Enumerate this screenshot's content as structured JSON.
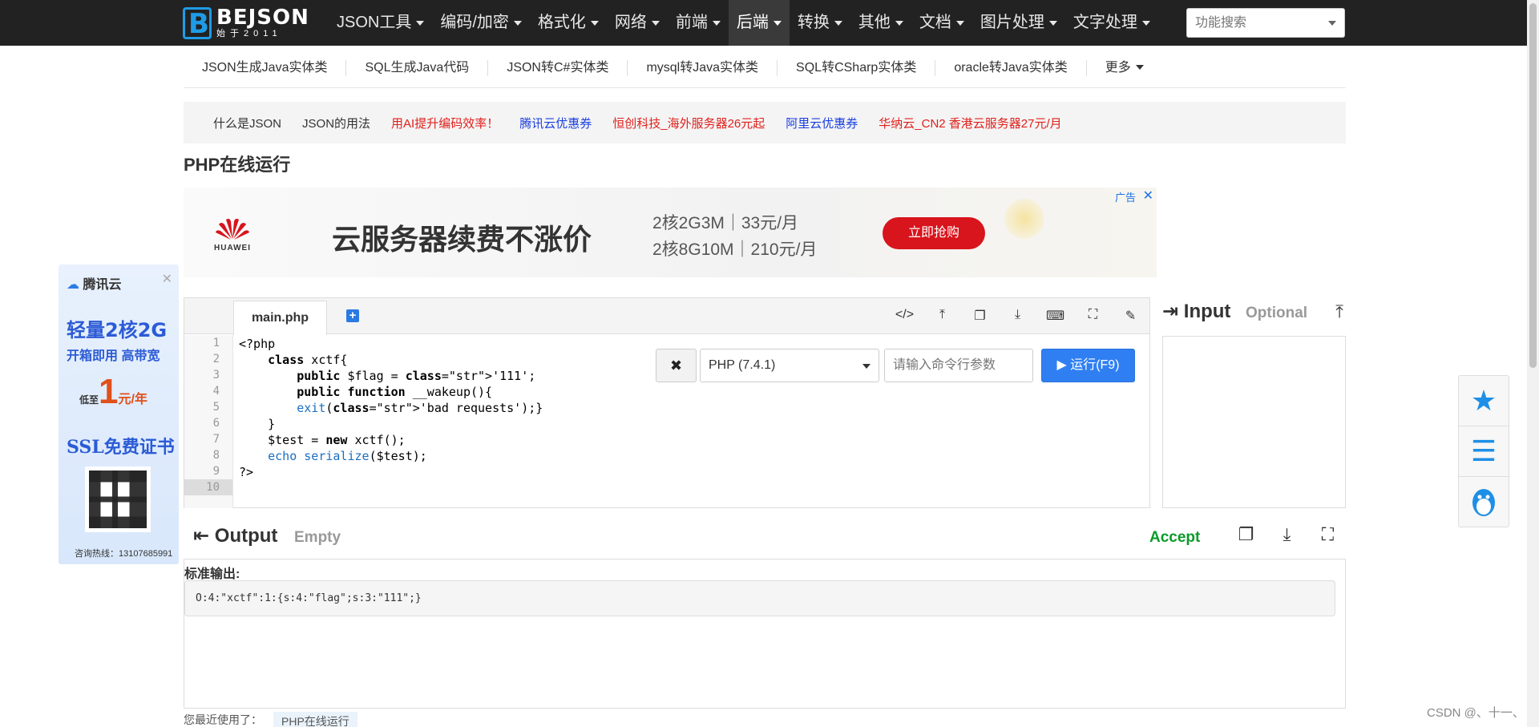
{
  "topnav": {
    "logo_title": "BEJSON",
    "logo_sub": "始于2011",
    "items": [
      {
        "label": "JSON工具",
        "active": false
      },
      {
        "label": "编码/加密",
        "active": false
      },
      {
        "label": "格式化",
        "active": false
      },
      {
        "label": "网络",
        "active": false
      },
      {
        "label": "前端",
        "active": false
      },
      {
        "label": "后端",
        "active": true
      },
      {
        "label": "转换",
        "active": false
      },
      {
        "label": "其他",
        "active": false
      },
      {
        "label": "文档",
        "active": false
      },
      {
        "label": "图片处理",
        "active": false
      },
      {
        "label": "文字处理",
        "active": false
      }
    ],
    "search_placeholder": "功能搜索"
  },
  "subnav": {
    "items": [
      "JSON生成Java实体类",
      "SQL生成Java代码",
      "JSON转C#实体类",
      "mysql转Java实体类",
      "SQL转CSharp实体类",
      "oracle转Java实体类",
      "更多"
    ]
  },
  "linkbar": {
    "items": [
      {
        "label": "什么是JSON",
        "color": "#333333"
      },
      {
        "label": "JSON的用法",
        "color": "#333333"
      },
      {
        "label": "用AI提升编码效率！",
        "color": "#e0201b"
      },
      {
        "label": "腾讯云优惠券",
        "color": "#1a3ee0"
      },
      {
        "label": "恒创科技_海外服务器26元起",
        "color": "#e0201b"
      },
      {
        "label": "阿里云优惠券",
        "color": "#1a3ee0"
      },
      {
        "label": "华纳云_CN2 香港云服务器27元/月",
        "color": "#e0201b"
      }
    ]
  },
  "page_title": "PHP在线运行",
  "banner": {
    "brand": "HUAWEI",
    "headline": "云服务器续费不涨价",
    "price1": "2核2G3M｜33元/月",
    "price2": "2核8G10M｜210元/月",
    "cta": "立即抢购",
    "ad_tag": "广告",
    "close": "✕"
  },
  "leftad": {
    "brand": "腾讯云",
    "line1": "轻量2核2G",
    "line2": "开箱即用 高带宽",
    "price_pre": "低至",
    "price": "1",
    "price_suf": "元/年",
    "line4": "SSL免费证书",
    "tel": "咨询热线：13107685991",
    "close": "✕"
  },
  "editor": {
    "tab": "main.php",
    "line_numbers": [
      "1",
      "2",
      "3",
      "4",
      "5",
      "6",
      "7",
      "8",
      "9",
      "10"
    ],
    "code_lines": [
      "<?php",
      "    class xctf{",
      "        public $flag = '111';",
      "        public function __wakeup(){",
      "        exit('bad requests');}",
      "    }",
      "    $test = new xctf();",
      "    echo serialize($test);",
      "?>",
      ""
    ],
    "clear_label": "✖",
    "php_version": "PHP (7.4.1)",
    "args_placeholder": "请输入命令行参数",
    "run_label": "▶ 运行(F9)"
  },
  "input_panel": {
    "title": "Input",
    "optional": "Optional"
  },
  "output": {
    "title": "Output",
    "status": "Empty",
    "accept": "Accept",
    "stdout_label": "标准输出:",
    "stdout_value": "O:4:\"xctf\":1:{s:4:\"flag\";s:3:\"111\";}"
  },
  "recent": {
    "label": "您最近使用了：",
    "item": "PHP在线运行"
  },
  "watermark": "CSDN @、十一、"
}
